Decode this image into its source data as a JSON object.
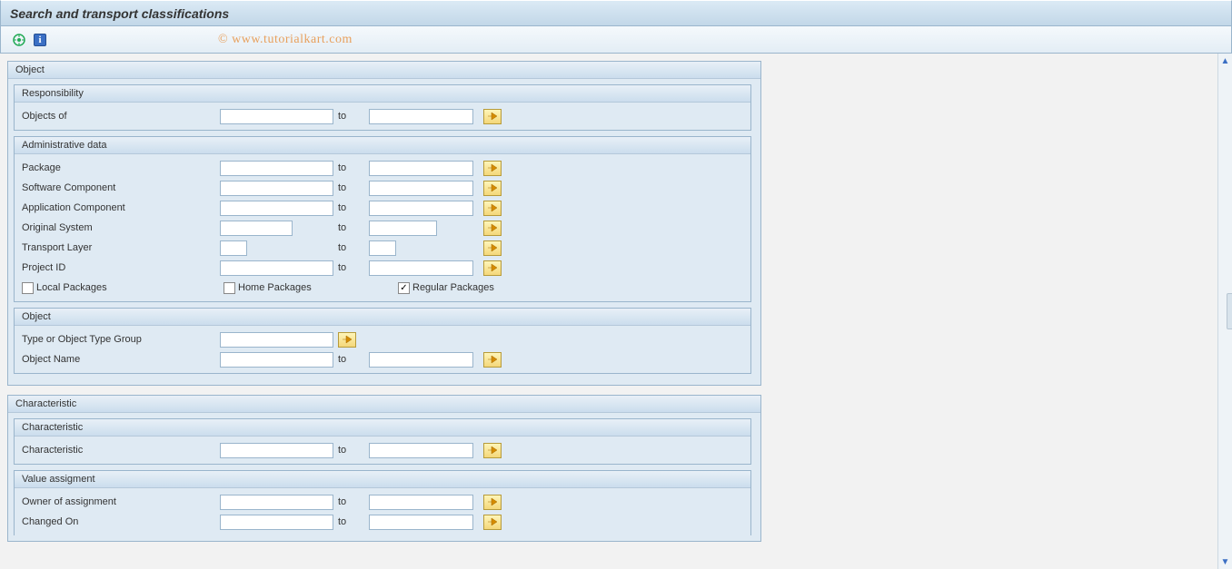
{
  "title": "Search and transport classifications",
  "watermark": "© www.tutorialkart.com",
  "labels": {
    "to": "to"
  },
  "groups": {
    "object": {
      "title": "Object",
      "responsibility": {
        "title": "Responsibility",
        "objects_of": "Objects of"
      },
      "admin": {
        "title": "Administrative data",
        "package": "Package",
        "software_component": "Software Component",
        "application_component": "Application Component",
        "original_system": "Original System",
        "transport_layer": "Transport Layer",
        "project_id": "Project ID",
        "local_packages": "Local Packages",
        "home_packages": "Home Packages",
        "regular_packages": "Regular Packages",
        "regular_checked": true
      },
      "obj": {
        "title": "Object",
        "type_group": "Type or Object Type Group",
        "object_name": "Object Name"
      }
    },
    "characteristic": {
      "title": "Characteristic",
      "char": {
        "title": "Characteristic",
        "characteristic": "Characteristic"
      },
      "value": {
        "title": "Value assigment",
        "owner": "Owner of assignment",
        "changed_on": "Changed On"
      }
    }
  }
}
